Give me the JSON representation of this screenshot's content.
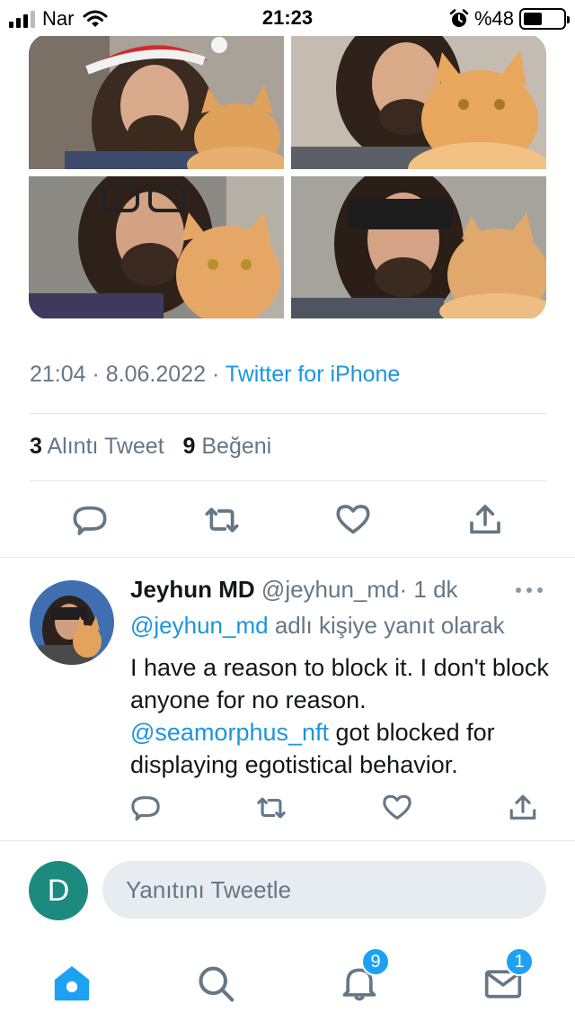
{
  "status_bar": {
    "carrier": "Nar",
    "time": "21:23",
    "battery_text": "%48",
    "battery_level": 0.48
  },
  "photos": [
    {
      "icon": "man-santa-hat-cat-photo"
    },
    {
      "icon": "man-cat-closeup-photo"
    },
    {
      "icon": "man-glasses-cat-photo"
    },
    {
      "icon": "man-sunglasses-cat-photo"
    }
  ],
  "tweet": {
    "time": "21:04",
    "date": "8.06.2022",
    "separator": "·",
    "source": "Twitter for iPhone",
    "quote_count": "3",
    "quote_label": "Alıntı Tweet",
    "like_count": "9",
    "like_label": "Beğeni"
  },
  "reply": {
    "name": "Jeyhun MD",
    "handle": "@jeyhun_md",
    "time": "· 1 dk",
    "reply_to_mention": "@jeyhun_md",
    "reply_to_suffix": " adlı kişiye yanıt olarak",
    "text_1": "I have a reason to block it. I don't block anyone for no reason.",
    "mention": "@seamorphus_nft",
    "text_2": " got blocked for displaying egotistical behavior."
  },
  "compose": {
    "avatar_letter": "D",
    "placeholder": "Yanıtını Tweetle",
    "avatar_color": "#1d8a80"
  },
  "tab_bar": {
    "notifications_badge": "9",
    "messages_badge": "1"
  },
  "colors": {
    "accent": "#1da1f2",
    "link": "#1b95e0",
    "muted": "#657786"
  }
}
